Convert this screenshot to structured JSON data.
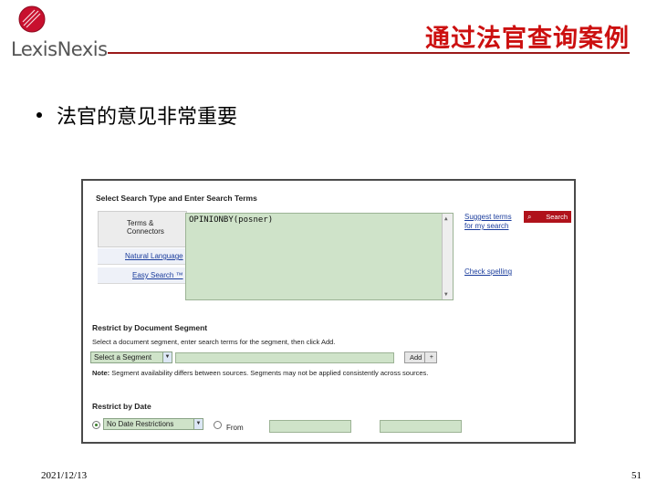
{
  "brand": {
    "logo_text": "LexisNexis",
    "accent_color": "#cc1010"
  },
  "slide": {
    "title": "通过法官查询案例",
    "bullet": "法官的意见非常重要",
    "date": "2021/12/13",
    "page_number": "51"
  },
  "screenshot": {
    "heading": "Select Search Type and Enter Search Terms",
    "tabs": {
      "terms_connectors": "Terms & Connectors",
      "natural_language": "Natural Language",
      "easy_search": "Easy Search ™"
    },
    "query_value": "OPINIONBY(posner)",
    "suggest_link": "Suggest terms for my search",
    "check_spelling_link": "Check spelling",
    "search_button": "Search",
    "restrict_segment": {
      "heading": "Restrict by Document Segment",
      "instruction": "Select a document segment, enter search terms for the segment, then click Add.",
      "dropdown_value": "Select a Segment",
      "add_button": "Add",
      "note_label": "Note:",
      "note_text": "Segment availability differs between sources. Segments may not be applied consistently across sources."
    },
    "restrict_date": {
      "heading": "Restrict by Date",
      "dropdown_value": "No Date Restrictions",
      "from_label": "From"
    }
  }
}
